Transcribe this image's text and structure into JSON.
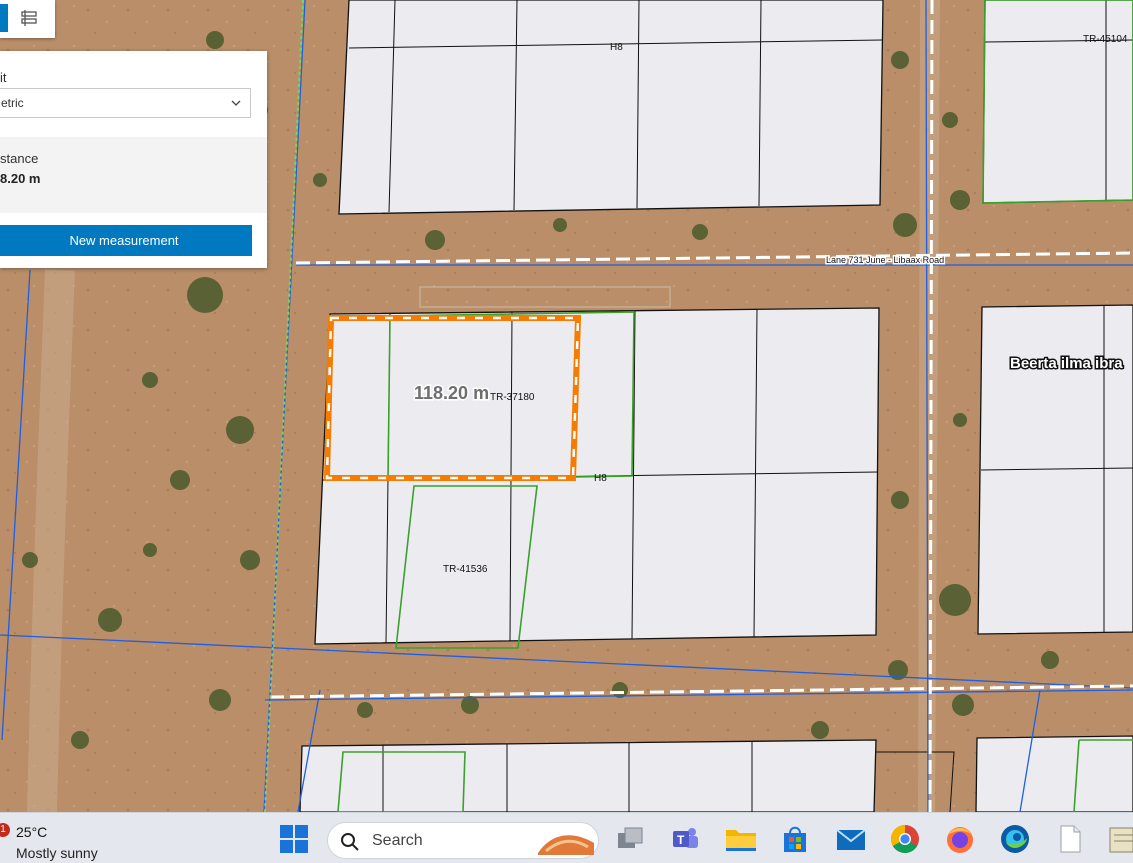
{
  "toolbar": {
    "active_tool_icon": "measure-icon",
    "layer_tool_icon": "layers-icon"
  },
  "measurement_panel": {
    "unit_label": "it",
    "unit_value": "etric",
    "result_label": "stance",
    "result_value": "8.20 m",
    "new_button_label": "New measurement"
  },
  "map": {
    "measured_label": "118.20 m",
    "parcel_labels": {
      "h8_top": "H8",
      "h8_mid": "H8",
      "tr45104": "TR-45104",
      "tr37180": "TR-37180",
      "tr41536": "TR-41536"
    },
    "road_label": "Lane 731 June - Libaax Road",
    "place_label": "Beerta ilma ibra",
    "colors": {
      "measure_outline": "#f57c00",
      "parcel_black": "#111111",
      "parcel_green": "#3aa12a",
      "road_blue": "#1f5fe0"
    }
  },
  "taskbar": {
    "notification_count": "1",
    "temperature": "25°C",
    "condition": "Mostly sunny",
    "search_placeholder": "Search",
    "apps": [
      "windows-start-icon",
      "task-view-icon",
      "teams-icon",
      "file-explorer-icon",
      "microsoft-store-icon",
      "mail-icon",
      "chrome-icon",
      "firefox-icon",
      "edge-icon",
      "file-icon",
      "notepad-icon"
    ]
  }
}
